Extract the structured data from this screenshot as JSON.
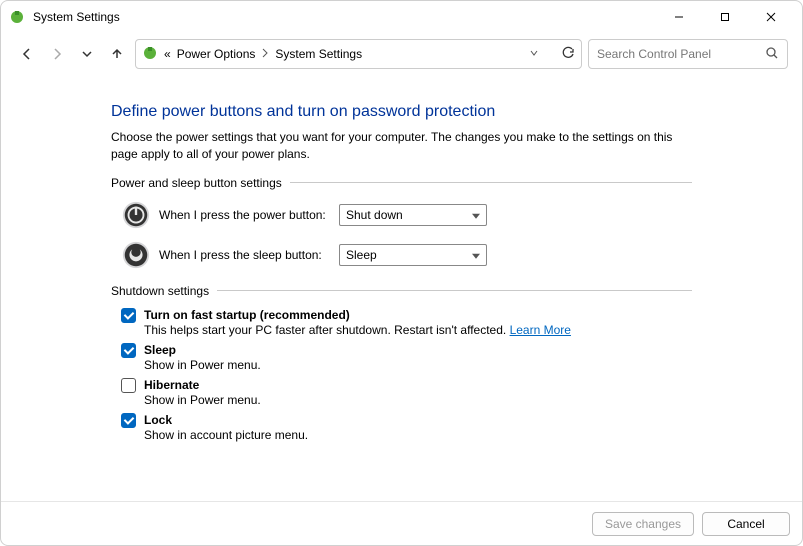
{
  "window_title": "System Settings",
  "breadcrumb": {
    "prefix": "«",
    "items": [
      "Power Options",
      "System Settings"
    ]
  },
  "search": {
    "placeholder": "Search Control Panel"
  },
  "heading": "Define power buttons and turn on password protection",
  "subtext": "Choose the power settings that you want for your computer. The changes you make to the settings on this page apply to all of your power plans.",
  "sections": {
    "power_sleep": {
      "legend": "Power and sleep button settings",
      "power_btn_label": "When I press the power button:",
      "power_btn_value": "Shut down",
      "sleep_btn_label": "When I press the sleep button:",
      "sleep_btn_value": "Sleep"
    },
    "shutdown": {
      "legend": "Shutdown settings",
      "fast_startup": {
        "label": "Turn on fast startup (recommended)",
        "desc": "This helps start your PC faster after shutdown. Restart isn't affected. ",
        "link": "Learn More",
        "checked": true
      },
      "sleep": {
        "label": "Sleep",
        "desc": "Show in Power menu.",
        "checked": true
      },
      "hibernate": {
        "label": "Hibernate",
        "desc": "Show in Power menu.",
        "checked": false
      },
      "lock": {
        "label": "Lock",
        "desc": "Show in account picture menu.",
        "checked": true
      }
    }
  },
  "buttons": {
    "save": "Save changes",
    "cancel": "Cancel"
  }
}
